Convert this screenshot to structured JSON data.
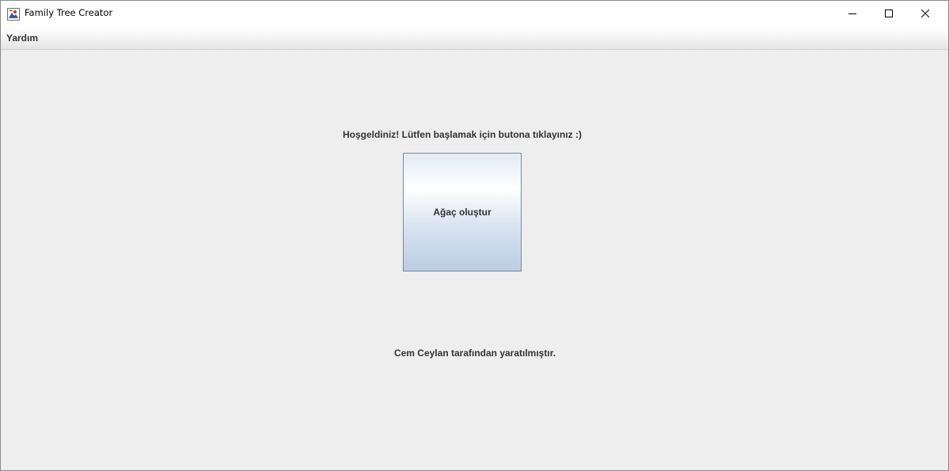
{
  "window": {
    "title": "Family Tree Creator",
    "app_icon": "java-app-icon",
    "controls": [
      "minimize-icon",
      "maximize-icon",
      "close-icon"
    ]
  },
  "menubar": {
    "items": [
      {
        "label": "Yardım"
      }
    ]
  },
  "main": {
    "welcome_text": "Hoşgeldiniz! Lütfen başlamak için butona tıklayınız :)",
    "create_button_label": "Ağaç oluştur",
    "author_text": "Cem Ceylan tarafından yaratılmıştır."
  },
  "colors": {
    "background": "#eeeeee",
    "text": "#333333",
    "button_border": "#7a8aa0",
    "button_gradient_bottom": "#bacde4"
  }
}
